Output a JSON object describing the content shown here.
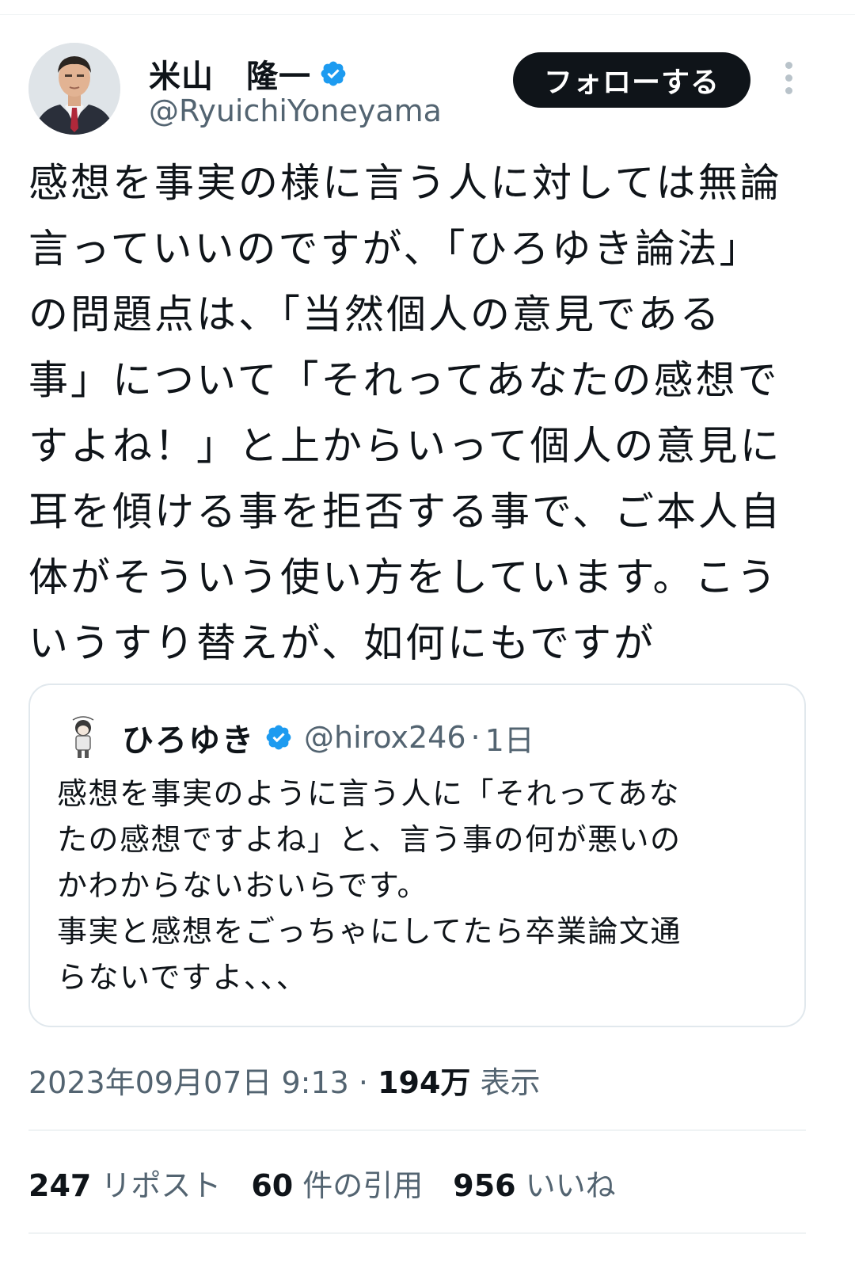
{
  "author": {
    "display_name": "米山　隆一",
    "handle": "@RyuichiYoneyama",
    "verified_icon": "verified-badge-icon",
    "avatar_icon": "avatar-photo"
  },
  "actions": {
    "follow_label": "フォローする",
    "more_icon": "more-vertical-icon"
  },
  "tweet": {
    "text": "感想を事実の様に言う人に対しては無論\n言っていいのですが、「ひろゆき論法」\nの問題点は、「当然個人の意見である\n事」について「それってあなたの感想で\nすよね！」と上からいって個人の意見に\n耳を傾ける事を拒否する事で、ご本人自\n体がそういう使い方をしています。こう\nいうすり替えが、如何にもですが"
  },
  "quote": {
    "display_name": "ひろゆき",
    "handle": "@hirox246",
    "separator": "·",
    "time": "1日",
    "text": "感想を事実のように言う人に「それってあな\nたの感想ですよね」と、言う事の何が悪いの\nかわからないおいらです。\n事実と感想をごっちゃにしてたら卒業論文通\nらないですよ、、、"
  },
  "meta": {
    "timestamp": "2023年09月07日 9:13",
    "separator": "·",
    "views_count": "194万",
    "views_label": "表示"
  },
  "stats": {
    "reposts_count": "247",
    "reposts_label": "リポスト",
    "quotes_count": "60",
    "quotes_label": "件の引用",
    "likes_count": "956",
    "likes_label": "いいね"
  },
  "colors": {
    "accent": "#1d9bf0",
    "text": "#0f1419",
    "secondary": "#536471",
    "button_bg": "#0f1419"
  }
}
